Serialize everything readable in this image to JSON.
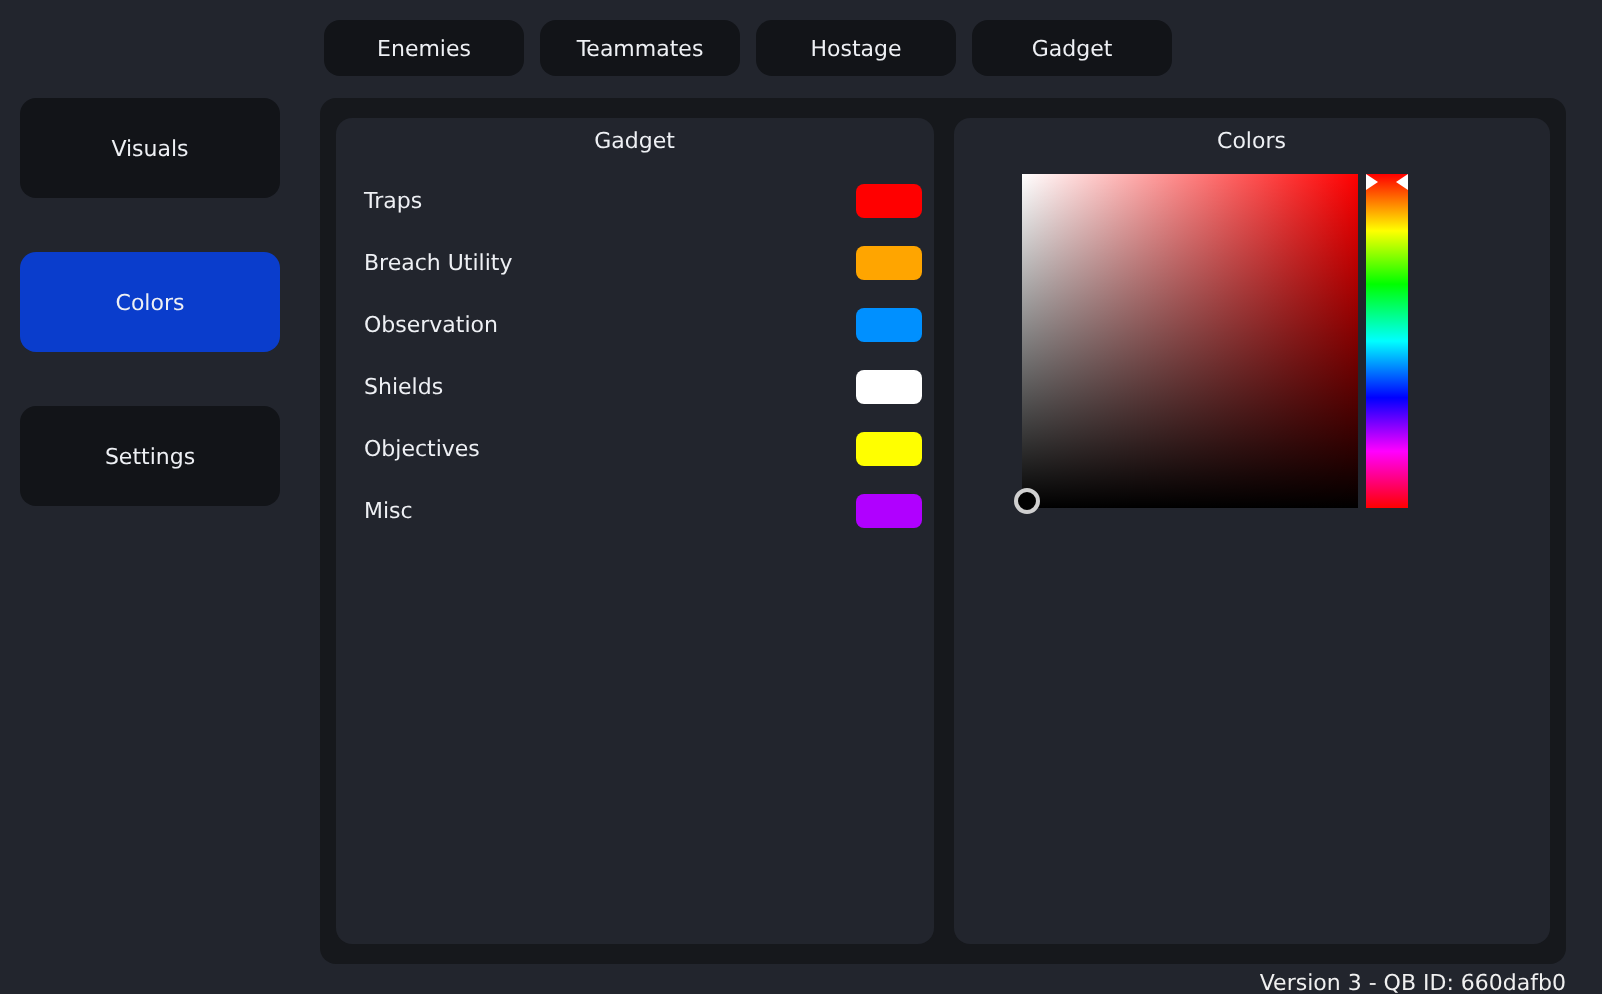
{
  "top_tabs": [
    {
      "label": "Enemies",
      "selected": false
    },
    {
      "label": "Teammates",
      "selected": false
    },
    {
      "label": "Hostage",
      "selected": false
    },
    {
      "label": "Gadget",
      "selected": false
    }
  ],
  "sidebar": {
    "items": [
      {
        "label": "Visuals",
        "selected": false
      },
      {
        "label": "Colors",
        "selected": true
      },
      {
        "label": "Settings",
        "selected": false
      }
    ]
  },
  "gadget_panel": {
    "title": "Gadget",
    "rows": [
      {
        "label": "Traps",
        "color": "#ff0000"
      },
      {
        "label": "Breach Utility",
        "color": "#ffa500"
      },
      {
        "label": "Observation",
        "color": "#0090ff"
      },
      {
        "label": "Shields",
        "color": "#ffffff"
      },
      {
        "label": "Objectives",
        "color": "#ffff00"
      },
      {
        "label": "Misc",
        "color": "#b000ff"
      }
    ]
  },
  "colors_panel": {
    "title": "Colors",
    "hue": {
      "level": 0
    }
  },
  "status_bar": "Version 3 - QB ID: 660dafb0"
}
